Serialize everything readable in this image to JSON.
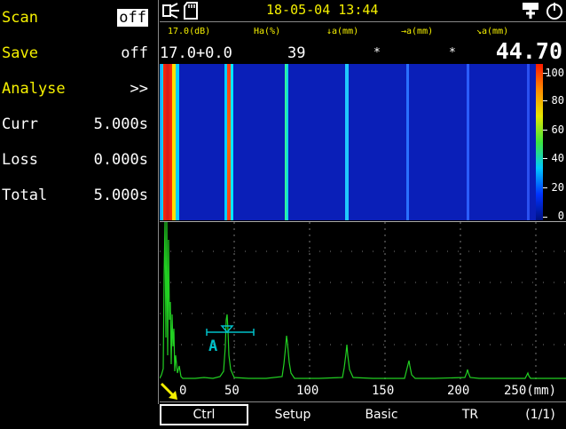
{
  "menu": {
    "scan": {
      "label": "Scan",
      "value": "off"
    },
    "save": {
      "label": "Save",
      "value": "off"
    },
    "analyse": {
      "label": "Analyse",
      "value": ">>"
    },
    "curr": {
      "label": "Curr",
      "value": "5.000s"
    },
    "loss": {
      "label": "Loss",
      "value": "0.000s"
    },
    "total": {
      "label": "Total",
      "value": "5.000s"
    }
  },
  "status": {
    "datetime": "18-05-04 13:44",
    "icons": [
      "probe-icon",
      "sd-card-icon",
      "usb-icon"
    ]
  },
  "header": {
    "labels": [
      "17.0(dB)",
      "Ha(%)",
      "↓a(mm)",
      "→a(mm)",
      "↘a(mm)"
    ],
    "values": [
      "17.0+0.0",
      "39",
      "*",
      "*"
    ],
    "big_value": "44.70"
  },
  "colorbar": {
    "labels": [
      "100",
      "80",
      "60",
      "40",
      "20",
      "0"
    ],
    "colors": [
      "#ff1a00",
      "#ff8c00",
      "#e6e600",
      "#3ee63e",
      "#00c8ff",
      "#0033ff"
    ]
  },
  "ascan": {
    "gate_label": "A",
    "x_ticks": [
      "0",
      "50",
      "100",
      "150",
      "200",
      "250(mm)"
    ],
    "trace_color": "#22d022",
    "gate_color": "#00c0c8"
  },
  "tabs": {
    "ctrl": "Ctrl",
    "setup": "Setup",
    "basic": "Basic",
    "tr": "TR",
    "page": "(1/1)"
  }
}
